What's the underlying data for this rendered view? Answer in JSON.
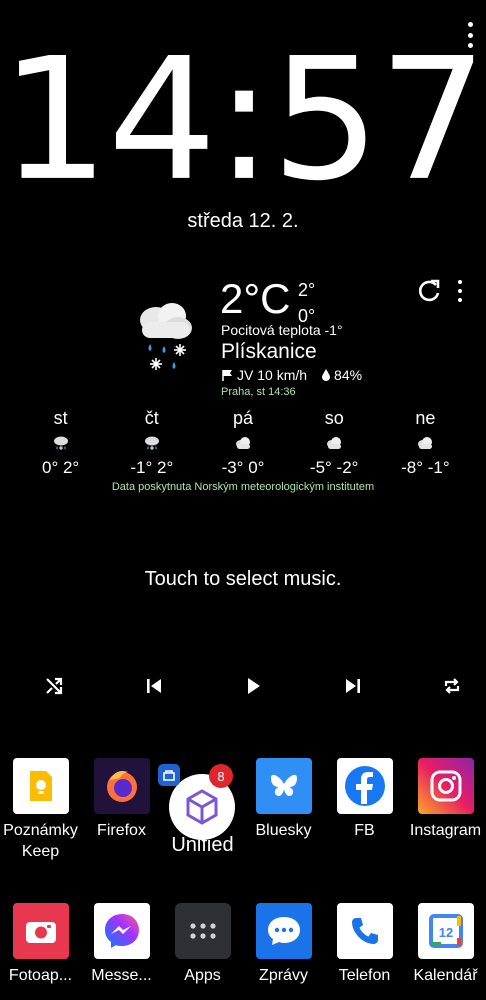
{
  "clock": {
    "time": "14:57",
    "date": "středa 12. 2."
  },
  "weather": {
    "temp": "2°C",
    "high": "2°",
    "low": "0°",
    "feels": "Pocitová teplota -1°",
    "condition": "Plískanice",
    "wind": "JV 10 km/h",
    "humidity": "84%",
    "place": "Praha, st 14:36",
    "source": "Data poskytnuta Norským meteorologickým institutem",
    "icon": "sleet-cloud-icon",
    "forecast": [
      {
        "day": "st",
        "range": "0° 2°",
        "icon": "sleet-icon"
      },
      {
        "day": "čt",
        "range": "-1° 2°",
        "icon": "sleet-icon"
      },
      {
        "day": "pá",
        "range": "-3° 0°",
        "icon": "cloud-icon"
      },
      {
        "day": "so",
        "range": "-5° -2°",
        "icon": "cloud-icon"
      },
      {
        "day": "ne",
        "range": "-8° -1°",
        "icon": "cloud-icon"
      }
    ]
  },
  "music": {
    "prompt": "Touch to select music.",
    "controls": [
      "shuffle-icon",
      "previous-icon",
      "play-icon",
      "next-icon",
      "repeat-icon"
    ]
  },
  "apps_row1": [
    {
      "label": "Poznámky Keep",
      "icon": "keep-icon"
    },
    {
      "label": "Firefox",
      "icon": "firefox-icon"
    },
    {
      "label": "Unified",
      "icon": "unified-icon",
      "badge": "8"
    },
    {
      "label": "Bluesky",
      "icon": "bluesky-icon"
    },
    {
      "label": "FB",
      "icon": "facebook-icon"
    },
    {
      "label": "Instagram",
      "icon": "instagram-icon"
    }
  ],
  "apps_row2": [
    {
      "label": "Fotoap...",
      "icon": "camera-icon"
    },
    {
      "label": "Messe...",
      "icon": "messenger-icon"
    },
    {
      "label": "Apps",
      "icon": "apps-grid-icon"
    },
    {
      "label": "Zprávy",
      "icon": "messages-icon"
    },
    {
      "label": "Telefon",
      "icon": "phone-icon"
    },
    {
      "label": "Kalendář",
      "icon": "calendar-icon",
      "calendar_day": "12"
    }
  ],
  "colors": {
    "background": "#000000",
    "accent_green": "#a6e7a6",
    "badge_red": "#e0262d",
    "bluesky": "#2f8ff5",
    "facebook": "#1877f2"
  }
}
